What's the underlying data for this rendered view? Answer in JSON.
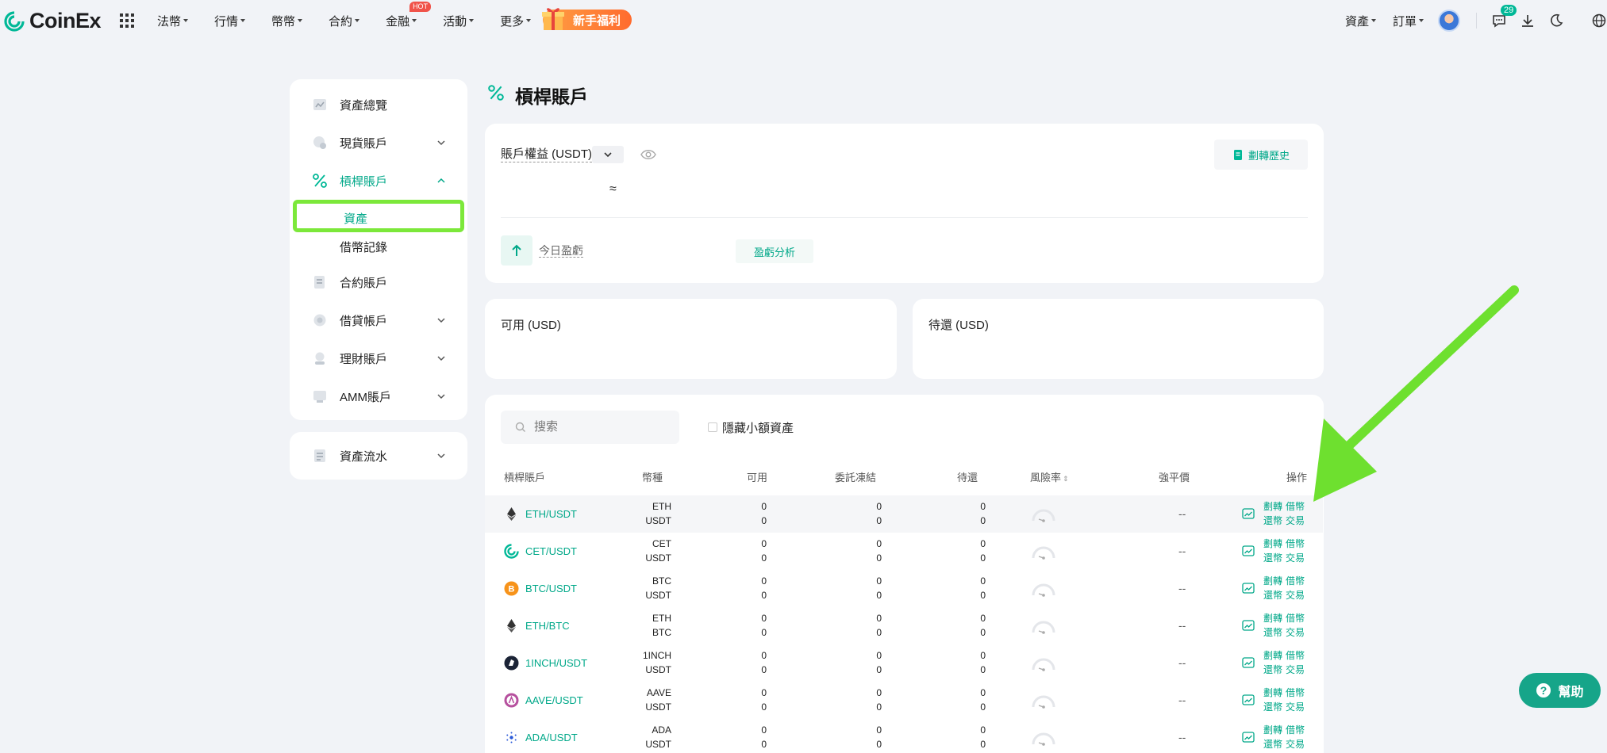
{
  "brand": {
    "name": "CoinEx",
    "accent": "#00b897",
    "highlight": "#7ce83a"
  },
  "nav": {
    "items": [
      "法幣",
      "行情",
      "幣幣",
      "合約",
      "金融",
      "活動",
      "更多"
    ],
    "hot_badge": "HOT",
    "promo": "新手福利",
    "assets": "資產",
    "orders": "訂單",
    "notif_count": "29"
  },
  "sidebar": {
    "overview": "資產總覽",
    "spot": "現貨賬戶",
    "margin": "槓桿賬戶",
    "margin_assets": "資產",
    "margin_borrow": "借幣記錄",
    "futures": "合約賬戶",
    "loan": "借貸帳戶",
    "finance": "理財賬戶",
    "amm": "AMM賬戶",
    "flow": "資產流水"
  },
  "page": {
    "title": "槓桿賬戶"
  },
  "equity": {
    "label": "賬戶權益 (USDT)",
    "approx": "≈",
    "history_button": "劃轉歷史",
    "today_pnl": "今日盈虧",
    "pnl_button": "盈虧分析"
  },
  "available": {
    "label": "可用 (USD)"
  },
  "due": {
    "label": "待還 (USD)"
  },
  "assets_table": {
    "search_placeholder": "搜索",
    "hide_small": "隱藏小額資產",
    "headers": {
      "account": "槓桿賬戶",
      "coin": "幣種",
      "available": "可用",
      "frozen": "委託凍結",
      "due": "待還",
      "risk": "風險率",
      "liq": "強平價",
      "ops": "操作"
    },
    "op_labels": {
      "transfer": "劃轉",
      "borrow": "借幣",
      "repay": "還幣",
      "trade": "交易"
    },
    "rows": [
      {
        "pair": "ETH/USDT",
        "base": "ETH",
        "quote": "USDT",
        "available": [
          "0",
          "0"
        ],
        "frozen": [
          "0",
          "0"
        ],
        "due": [
          "0",
          "0"
        ],
        "liq": "--",
        "icon": "eth-icon"
      },
      {
        "pair": "CET/USDT",
        "base": "CET",
        "quote": "USDT",
        "available": [
          "0",
          "0"
        ],
        "frozen": [
          "0",
          "0"
        ],
        "due": [
          "0",
          "0"
        ],
        "liq": "--",
        "icon": "cet-icon"
      },
      {
        "pair": "BTC/USDT",
        "base": "BTC",
        "quote": "USDT",
        "available": [
          "0",
          "0"
        ],
        "frozen": [
          "0",
          "0"
        ],
        "due": [
          "0",
          "0"
        ],
        "liq": "--",
        "icon": "btc-icon"
      },
      {
        "pair": "ETH/BTC",
        "base": "ETH",
        "quote": "BTC",
        "available": [
          "0",
          "0"
        ],
        "frozen": [
          "0",
          "0"
        ],
        "due": [
          "0",
          "0"
        ],
        "liq": "--",
        "icon": "eth-icon"
      },
      {
        "pair": "1INCH/USDT",
        "base": "1INCH",
        "quote": "USDT",
        "available": [
          "0",
          "0"
        ],
        "frozen": [
          "0",
          "0"
        ],
        "due": [
          "0",
          "0"
        ],
        "liq": "--",
        "icon": "1inch-icon"
      },
      {
        "pair": "AAVE/USDT",
        "base": "AAVE",
        "quote": "USDT",
        "available": [
          "0",
          "0"
        ],
        "frozen": [
          "0",
          "0"
        ],
        "due": [
          "0",
          "0"
        ],
        "liq": "--",
        "icon": "aave-icon"
      },
      {
        "pair": "ADA/USDT",
        "base": "ADA",
        "quote": "USDT",
        "available": [
          "0",
          "0"
        ],
        "frozen": [
          "0",
          "0"
        ],
        "due": [
          "0",
          "0"
        ],
        "liq": "--",
        "icon": "ada-icon"
      }
    ]
  },
  "help": {
    "label": "幫助"
  }
}
